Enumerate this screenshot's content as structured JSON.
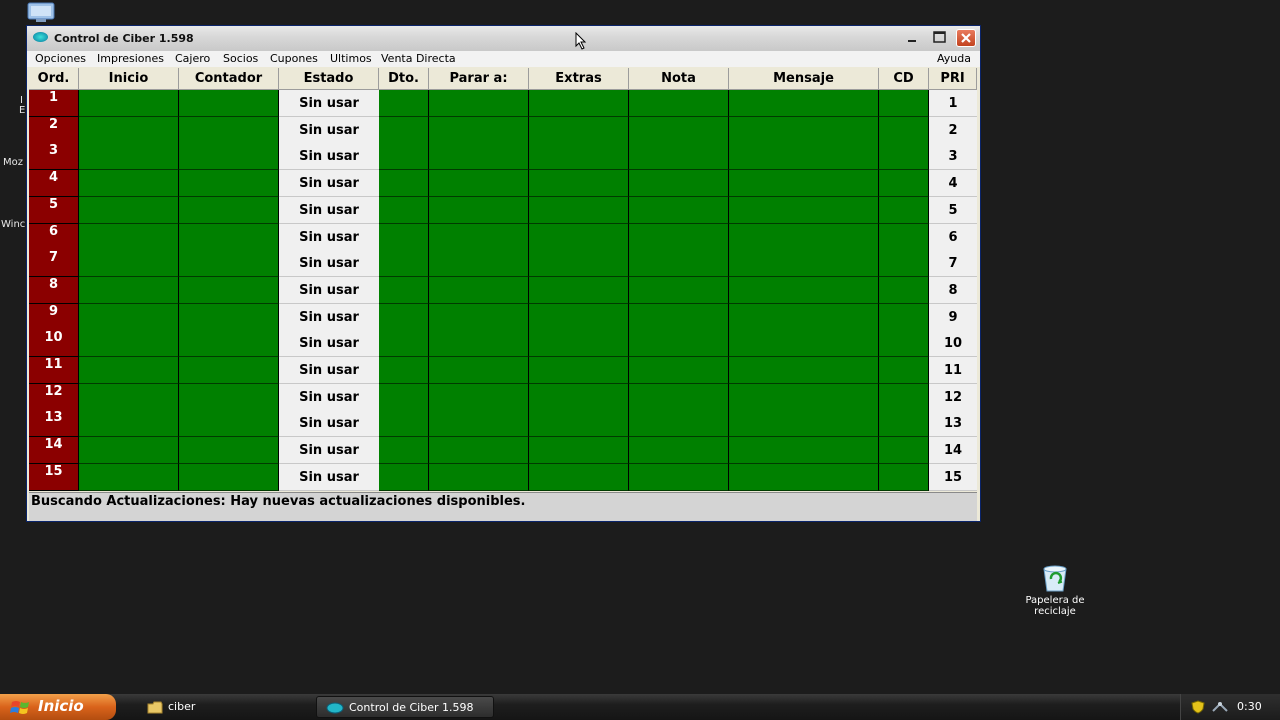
{
  "window": {
    "title": "Control de Ciber 1.598"
  },
  "menu": [
    "Opciones",
    "Impresiones",
    "Cajero",
    "Socios",
    "Cupones",
    "Ultimos",
    "Venta Directa",
    "Ayuda"
  ],
  "table": {
    "headers": [
      "Ord.",
      "Inicio",
      "Contador",
      "Estado",
      "Dto.",
      "Parar a:",
      "Extras",
      "Nota",
      "Mensaje",
      "CD",
      "PRI"
    ],
    "rows": [
      {
        "ord": "1",
        "estado": "Sin usar",
        "pri": "1"
      },
      {
        "ord": "2",
        "estado": "Sin usar",
        "pri": "2"
      },
      {
        "ord": "3",
        "estado": "Sin usar",
        "pri": "3"
      },
      {
        "ord": "4",
        "estado": "Sin usar",
        "pri": "4"
      },
      {
        "ord": "5",
        "estado": "Sin usar",
        "pri": "5"
      },
      {
        "ord": "6",
        "estado": "Sin usar",
        "pri": "6"
      },
      {
        "ord": "7",
        "estado": "Sin usar",
        "pri": "7"
      },
      {
        "ord": "8",
        "estado": "Sin usar",
        "pri": "8"
      },
      {
        "ord": "9",
        "estado": "Sin usar",
        "pri": "9"
      },
      {
        "ord": "10",
        "estado": "Sin usar",
        "pri": "10"
      },
      {
        "ord": "11",
        "estado": "Sin usar",
        "pri": "11"
      },
      {
        "ord": "12",
        "estado": "Sin usar",
        "pri": "12"
      },
      {
        "ord": "13",
        "estado": "Sin usar",
        "pri": "13"
      },
      {
        "ord": "14",
        "estado": "Sin usar",
        "pri": "14"
      },
      {
        "ord": "15",
        "estado": "Sin usar",
        "pri": "15"
      }
    ]
  },
  "status": "Buscando Actualizaciones: Hay nuevas actualizaciones disponibles.",
  "desktop": {
    "recycle_bin_label": "Papelera de reciclaje",
    "fragments": [
      "I",
      "E",
      "Moz",
      "Winc"
    ]
  },
  "taskbar": {
    "start_label": "Inicio",
    "tasks": [
      "ciber",
      "Control de Ciber 1.598"
    ],
    "clock": "0:30"
  },
  "colors": {
    "ord_cell": "#8b0000",
    "empty_cell": "#008000",
    "estado_cell": "#f0f0f0",
    "desktop": "#1c1c1c"
  }
}
